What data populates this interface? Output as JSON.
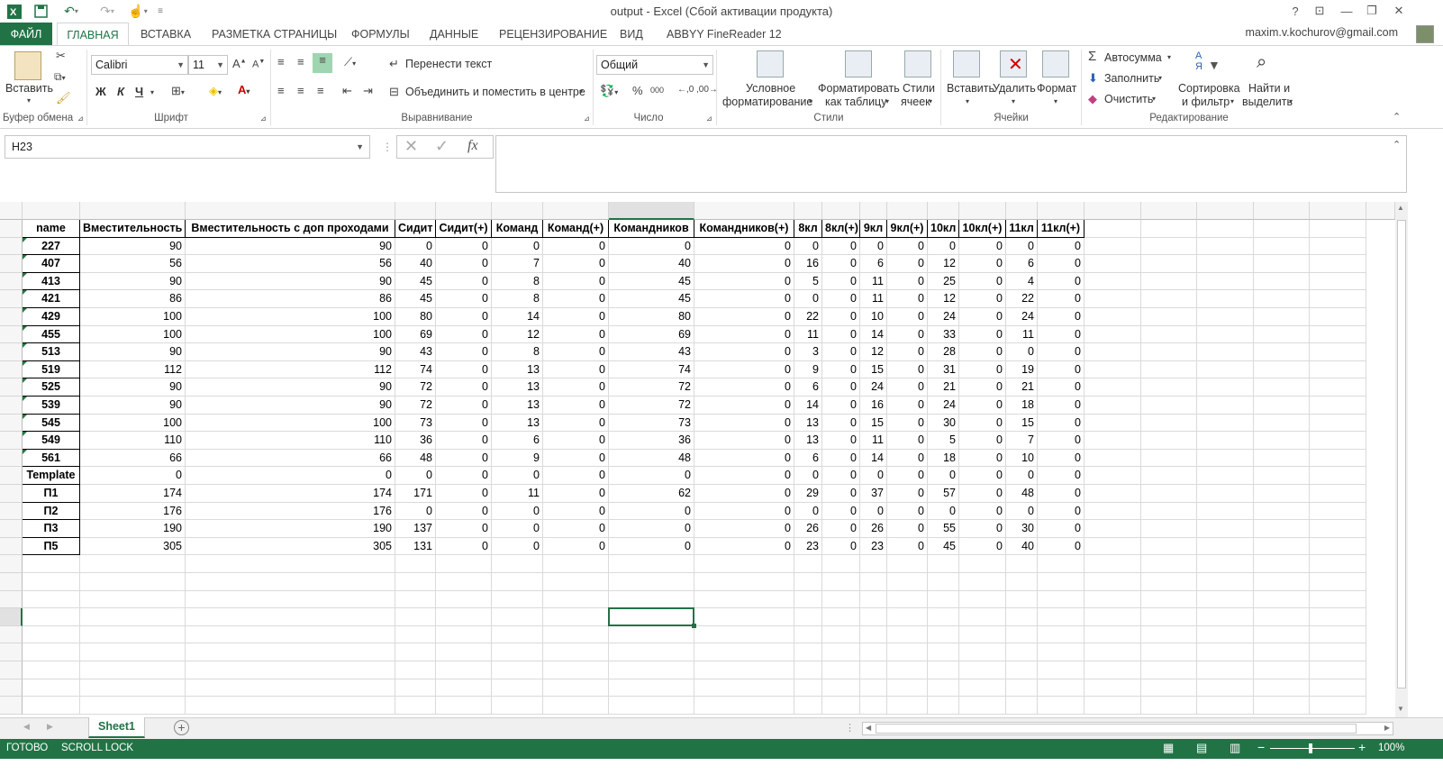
{
  "title": "output - Excel (Сбой активации продукта)",
  "tabs": [
    "ФАЙЛ",
    "ГЛАВНАЯ",
    "ВСТАВКА",
    "РАЗМЕТКА СТРАНИЦЫ",
    "ФОРМУЛЫ",
    "ДАННЫЕ",
    "РЕЦЕНЗИРОВАНИЕ",
    "ВИД",
    "ABBYY FineReader 12"
  ],
  "user": "maxim.v.kochurov@gmail.com",
  "ribbon": {
    "paste": "Вставить",
    "font_name": "Calibri",
    "font_size": "11",
    "bold": "Ж",
    "italic": "К",
    "underline": "Ч",
    "wrap_text": "Перенести текст",
    "merge_center": "Объединить и поместить в центре",
    "number_format": "Общий",
    "cond_format_1": "Условное",
    "cond_format_2": "форматирование",
    "format_table_1": "Форматировать",
    "format_table_2": "как таблицу",
    "cell_styles_1": "Стили",
    "cell_styles_2": "ячеек",
    "insert": "Вставить",
    "delete": "Удалить",
    "format": "Формат",
    "autosum": "Автосумма",
    "fill": "Заполнить",
    "clear": "Очистить",
    "sort_1": "Сортировка",
    "sort_2": "и фильтр",
    "find_1": "Найти и",
    "find_2": "выделить",
    "groups": {
      "clipboard": "Буфер обмена",
      "font": "Шрифт",
      "alignment": "Выравнивание",
      "number": "Число",
      "styles": "Стили",
      "cells": "Ячейки",
      "editing": "Редактирование"
    }
  },
  "name_box": "H23",
  "fx": "fx",
  "columns": [
    "A",
    "B",
    "C",
    "D",
    "E",
    "F",
    "G",
    "H",
    "I",
    "J",
    "K",
    "L",
    "M",
    "N",
    "O",
    "P",
    "Q",
    "R",
    "S",
    "T",
    "U",
    "V",
    "W"
  ],
  "selected_column": "H",
  "selected_row": "23",
  "row_numbers": [
    "1",
    "2",
    "3",
    "4",
    "5",
    "6",
    "7",
    "8",
    "9",
    "10",
    "11",
    "12",
    "13",
    "14",
    "15",
    "16",
    "17",
    "18",
    "19",
    "20",
    "21",
    "22",
    "23",
    "24",
    "25",
    "26",
    "27",
    "28"
  ],
  "sheet": {
    "headers": [
      "name",
      "Вместительность",
      "Вместительность с доп проходами",
      "Сидит",
      "Сидит(+)",
      "Команд",
      "Команд(+)",
      "Командников",
      "Командников(+)",
      "8кл",
      "8кл(+)",
      "9кл",
      "9кл(+)",
      "10кл",
      "10кл(+)",
      "11кл",
      "11кл(+)"
    ],
    "rows": [
      [
        "227",
        "90",
        "90",
        "0",
        "0",
        "0",
        "0",
        "0",
        "0",
        "0",
        "0",
        "0",
        "0",
        "0",
        "0",
        "0",
        "0"
      ],
      [
        "407",
        "56",
        "56",
        "40",
        "0",
        "7",
        "0",
        "40",
        "0",
        "16",
        "0",
        "6",
        "0",
        "12",
        "0",
        "6",
        "0"
      ],
      [
        "413",
        "90",
        "90",
        "45",
        "0",
        "8",
        "0",
        "45",
        "0",
        "5",
        "0",
        "11",
        "0",
        "25",
        "0",
        "4",
        "0"
      ],
      [
        "421",
        "86",
        "86",
        "45",
        "0",
        "8",
        "0",
        "45",
        "0",
        "0",
        "0",
        "11",
        "0",
        "12",
        "0",
        "22",
        "0"
      ],
      [
        "429",
        "100",
        "100",
        "80",
        "0",
        "14",
        "0",
        "80",
        "0",
        "22",
        "0",
        "10",
        "0",
        "24",
        "0",
        "24",
        "0"
      ],
      [
        "455",
        "100",
        "100",
        "69",
        "0",
        "12",
        "0",
        "69",
        "0",
        "11",
        "0",
        "14",
        "0",
        "33",
        "0",
        "11",
        "0"
      ],
      [
        "513",
        "90",
        "90",
        "43",
        "0",
        "8",
        "0",
        "43",
        "0",
        "3",
        "0",
        "12",
        "0",
        "28",
        "0",
        "0",
        "0"
      ],
      [
        "519",
        "112",
        "112",
        "74",
        "0",
        "13",
        "0",
        "74",
        "0",
        "9",
        "0",
        "15",
        "0",
        "31",
        "0",
        "19",
        "0"
      ],
      [
        "525",
        "90",
        "90",
        "72",
        "0",
        "13",
        "0",
        "72",
        "0",
        "6",
        "0",
        "24",
        "0",
        "21",
        "0",
        "21",
        "0"
      ],
      [
        "539",
        "90",
        "90",
        "72",
        "0",
        "13",
        "0",
        "72",
        "0",
        "14",
        "0",
        "16",
        "0",
        "24",
        "0",
        "18",
        "0"
      ],
      [
        "545",
        "100",
        "100",
        "73",
        "0",
        "13",
        "0",
        "73",
        "0",
        "13",
        "0",
        "15",
        "0",
        "30",
        "0",
        "15",
        "0"
      ],
      [
        "549",
        "110",
        "110",
        "36",
        "0",
        "6",
        "0",
        "36",
        "0",
        "13",
        "0",
        "11",
        "0",
        "5",
        "0",
        "7",
        "0"
      ],
      [
        "561",
        "66",
        "66",
        "48",
        "0",
        "9",
        "0",
        "48",
        "0",
        "6",
        "0",
        "14",
        "0",
        "18",
        "0",
        "10",
        "0"
      ],
      [
        "Template",
        "0",
        "0",
        "0",
        "0",
        "0",
        "0",
        "0",
        "0",
        "0",
        "0",
        "0",
        "0",
        "0",
        "0",
        "0",
        "0"
      ],
      [
        "П1",
        "174",
        "174",
        "171",
        "0",
        "11",
        "0",
        "62",
        "0",
        "29",
        "0",
        "37",
        "0",
        "57",
        "0",
        "48",
        "0"
      ],
      [
        "П2",
        "176",
        "176",
        "0",
        "0",
        "0",
        "0",
        "0",
        "0",
        "0",
        "0",
        "0",
        "0",
        "0",
        "0",
        "0",
        "0"
      ],
      [
        "П3",
        "190",
        "190",
        "137",
        "0",
        "0",
        "0",
        "0",
        "0",
        "26",
        "0",
        "26",
        "0",
        "55",
        "0",
        "30",
        "0"
      ],
      [
        "П5",
        "305",
        "305",
        "131",
        "0",
        "0",
        "0",
        "0",
        "0",
        "23",
        "0",
        "23",
        "0",
        "45",
        "0",
        "40",
        "0"
      ]
    ]
  },
  "sheet_tab": "Sheet1",
  "status": {
    "ready": "ГОТОВО",
    "scroll_lock": "SCROLL LOCK",
    "zoom": "100%"
  },
  "colors": {
    "accent": "#217346"
  }
}
